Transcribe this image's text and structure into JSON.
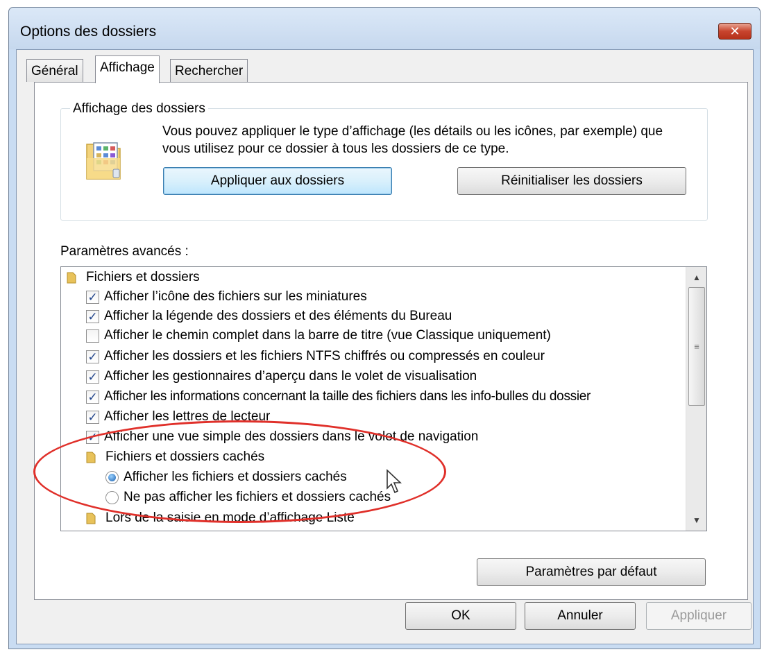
{
  "window": {
    "title": "Options des dossiers",
    "close_label": "✕"
  },
  "tabs": [
    {
      "label": "Général"
    },
    {
      "label": "Affichage"
    },
    {
      "label": "Rechercher"
    }
  ],
  "folder_view": {
    "group_title": "Affichage des dossiers",
    "description": "Vous pouvez appliquer le type d’affichage (les détails ou les icônes, par exemple) que vous utilisez pour ce dossier à tous les dossiers de ce type.",
    "apply_button": "Appliquer aux dossiers",
    "reset_button": "Réinitialiser les dossiers"
  },
  "advanced": {
    "label": "Paramètres avancés :",
    "items": [
      {
        "type": "folder",
        "label": "Fichiers et dossiers"
      },
      {
        "type": "checkbox",
        "checked": true,
        "label": "Afficher l’icône des fichiers sur les miniatures"
      },
      {
        "type": "checkbox",
        "checked": true,
        "label": "Afficher la légende des dossiers et des éléments du Bureau"
      },
      {
        "type": "checkbox",
        "checked": false,
        "label": "Afficher le chemin complet dans la barre de titre (vue Classique uniquement)"
      },
      {
        "type": "checkbox",
        "checked": true,
        "label": "Afficher les dossiers et les fichiers NTFS chiffrés ou compressés en couleur"
      },
      {
        "type": "checkbox",
        "checked": true,
        "label": "Afficher les gestionnaires d’aperçu dans le volet de visualisation"
      },
      {
        "type": "checkbox",
        "checked": true,
        "label": "Afficher les informations concernant la taille des fichiers dans les info-bulles du dossier"
      },
      {
        "type": "checkbox",
        "checked": true,
        "label": "Afficher les lettres de lecteur"
      },
      {
        "type": "checkbox",
        "checked": true,
        "label": "Afficher une vue simple des dossiers dans le volet de navigation"
      },
      {
        "type": "folder",
        "label": "Fichiers et dossiers cachés"
      },
      {
        "type": "radio",
        "checked": true,
        "label": "Afficher les fichiers et dossiers cachés"
      },
      {
        "type": "radio",
        "checked": false,
        "label": "Ne pas afficher les fichiers et dossiers cachés"
      },
      {
        "type": "folder",
        "label": "Lors de la saisie en mode d’affichage Liste"
      }
    ],
    "defaults_button": "Paramètres par défaut"
  },
  "footer": {
    "ok": "OK",
    "cancel": "Annuler",
    "apply": "Appliquer"
  },
  "colors": {
    "highlight": "#e0302a",
    "check": "#21448a",
    "accent": "#3c7fb1"
  }
}
